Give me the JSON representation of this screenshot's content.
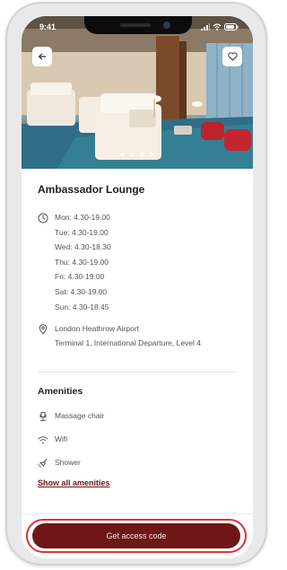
{
  "status_bar": {
    "time": "9:41"
  },
  "hero": {
    "back_icon": "arrow-left-icon",
    "favorite_icon": "heart-icon",
    "carousel": {
      "total": 4,
      "active_index": 2
    }
  },
  "lounge": {
    "name": "Ambassador Lounge",
    "hours": [
      "Mon: 4.30-19.00",
      "Tue: 4.30-19.00",
      "Wed: 4.30-18.30",
      "Thu: 4.30-19.00",
      "Fri: 4.30-19.00",
      "Sat: 4.30-19.00",
      "Sun: 4.30-18.45"
    ],
    "location": {
      "airport": "London Heathrow Airport",
      "terminal": "Terminal 1, International Departure, Level 4"
    }
  },
  "amenities": {
    "title": "Amenities",
    "items": [
      {
        "label": "Massage chair",
        "icon": "massage-chair-icon"
      },
      {
        "label": "Wifi",
        "icon": "wifi-icon"
      },
      {
        "label": "Shower",
        "icon": "shower-icon"
      }
    ],
    "show_all_label": "Show all amenities"
  },
  "cta": {
    "label": "Get access code"
  },
  "colors": {
    "brand": "#6e1717",
    "highlight": "#e0333b",
    "text_primary": "#1e1e1e",
    "text_secondary": "#555555"
  }
}
